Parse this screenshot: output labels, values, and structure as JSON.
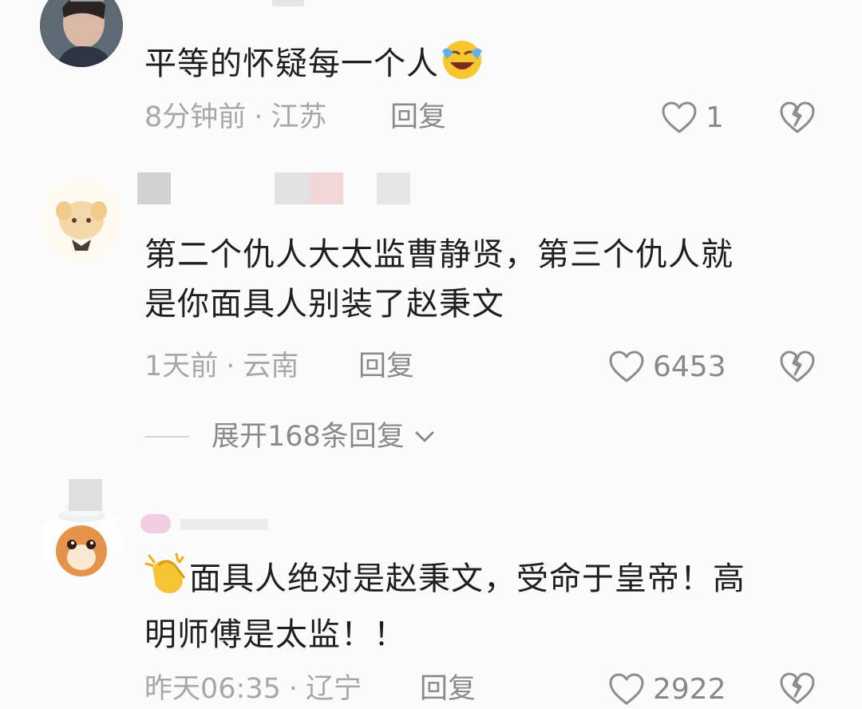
{
  "comments": [
    {
      "text": "平等的怀疑每一个人",
      "emoji": "laughing-crying-emoji",
      "time": "8分钟前",
      "location": "江苏",
      "reply_label": "回复",
      "likes": "1"
    },
    {
      "text_line1": "第二个仇人大太监曹静贤，第三个仇人就",
      "text_line2": "是你面具人别装了赵秉文",
      "time": "1天前",
      "location": "云南",
      "reply_label": "回复",
      "likes": "6453",
      "expand_label": "展开168条回复"
    },
    {
      "emoji": "clapping-hands-emoji",
      "text_line1": "面具人绝对是赵秉文，受命于皇帝！高",
      "text_line2": "明师傅是太监！！",
      "time": "昨天06:35",
      "location": "辽宁",
      "reply_label": "回复",
      "likes": "2922"
    }
  ],
  "separator": "·",
  "colors": {
    "background": "#fbfbfb",
    "text": "#1f1f1f",
    "meta": "#a7a7a7",
    "icon": "#8c8c8c"
  }
}
